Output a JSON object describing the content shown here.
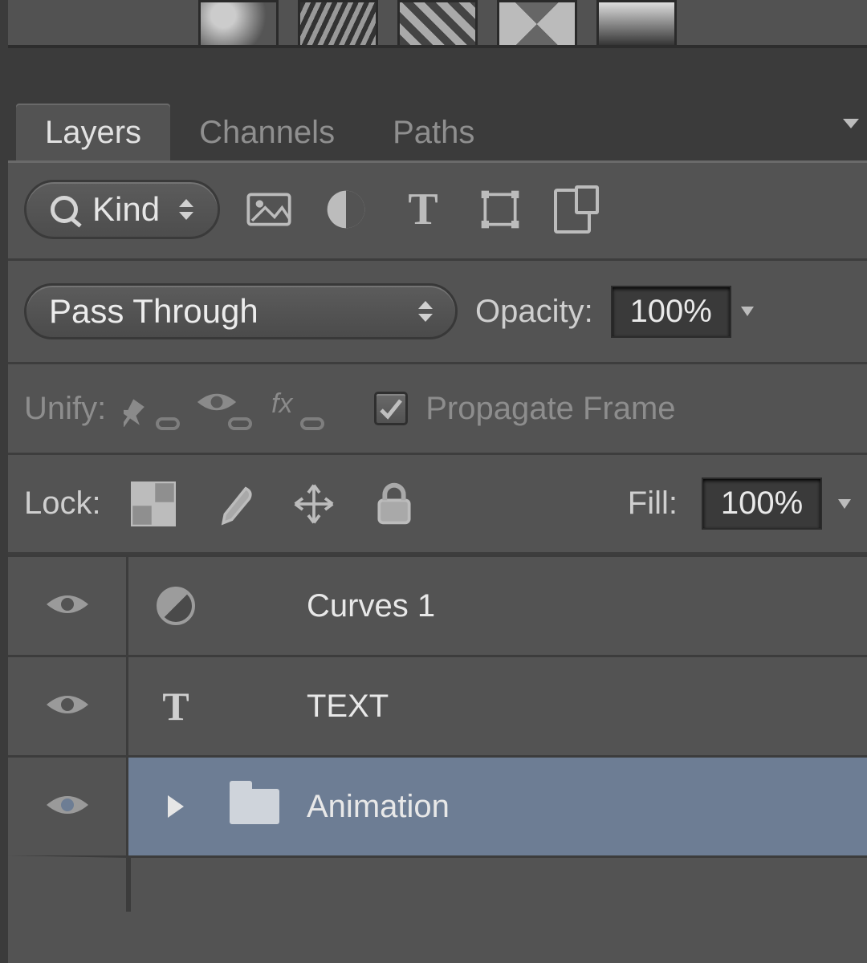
{
  "tabs": {
    "layers": "Layers",
    "channels": "Channels",
    "paths": "Paths"
  },
  "filter": {
    "kind_label": "Kind"
  },
  "blend": {
    "mode": "Pass Through",
    "opacity_label": "Opacity:",
    "opacity_value": "100%"
  },
  "unify": {
    "label": "Unify:",
    "propagate_label": "Propagate Frame"
  },
  "lock": {
    "label": "Lock:",
    "fill_label": "Fill:",
    "fill_value": "100%"
  },
  "layers": [
    {
      "name": "Curves 1"
    },
    {
      "name": "TEXT"
    },
    {
      "name": "Animation"
    }
  ]
}
